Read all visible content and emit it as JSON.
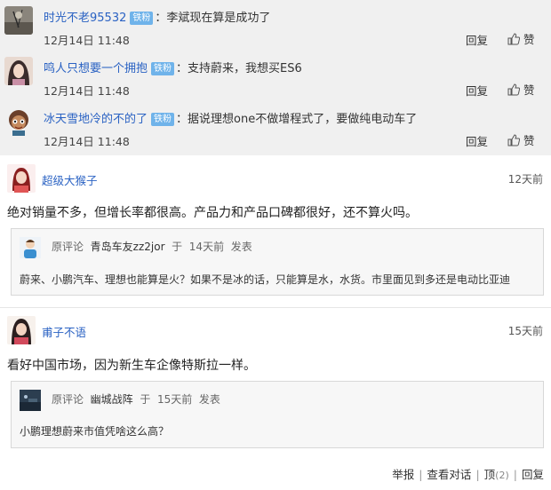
{
  "replies": [
    {
      "username": "时光不老95532",
      "badge": "铁粉",
      "text": "李斌现在算是成功了",
      "time": "12月14日 11:48",
      "reply_label": "回复",
      "like_label": "赞"
    },
    {
      "username": "鸣人只想要一个拥抱",
      "badge": "铁粉",
      "text": "支持蔚来，我想买ES6",
      "time": "12月14日 11:48",
      "reply_label": "回复",
      "like_label": "赞"
    },
    {
      "username": "冰天雪地冷的不的了",
      "badge": "铁粉",
      "text": "据说理想one不做增程式了，要做纯电动车了",
      "time": "12月14日 11:48",
      "reply_label": "回复",
      "like_label": "赞"
    }
  ],
  "comments": [
    {
      "username": "超级大猴子",
      "ago": "12天前",
      "body": "绝对销量不多，但增长率都很高。产品力和产品口碑都很好，还不算火吗。",
      "quote": {
        "label": "原评论",
        "user": "青岛车友zz2jor",
        "at": "于",
        "time": "14天前",
        "posted": "发表",
        "text": "蔚来、小鹏汽车、理想也能算是火？如果不是冰的话，只能算是水，水货。市里面见到多还是电动比亚迪"
      }
    },
    {
      "username": "甫子不语",
      "ago": "15天前",
      "body": "看好中国市场，因为新生车企像特斯拉一样。",
      "quote": {
        "label": "原评论",
        "user": "幽城战阵",
        "at": "于",
        "time": "15天前",
        "posted": "发表",
        "text": "小鹏理想蔚来市值凭啥这么高？"
      }
    }
  ],
  "actions": {
    "report": "举报",
    "view_dialog": "查看对话",
    "top": "顶",
    "top_count": "(2)",
    "reply": "回复"
  },
  "colors": {
    "link": "#2a62c3",
    "badge": "#6fb3ea",
    "reply_bg": "#f0f0f0"
  }
}
